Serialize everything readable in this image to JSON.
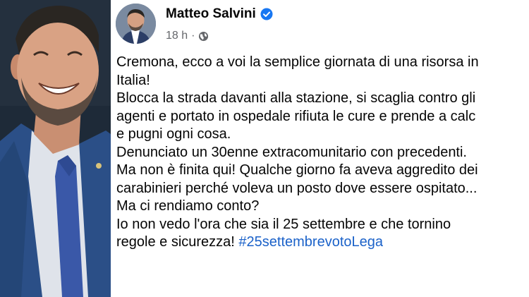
{
  "post": {
    "author": "Matteo Salvini",
    "verified_icon": "verified-badge-icon",
    "timestamp": "18 h",
    "separator": "·",
    "audience_icon": "globe-icon",
    "lines": [
      "Cremona, ecco a voi la semplice giornata di una risorsa in",
      "Italia!",
      "Blocca la strada davanti alla stazione, si scaglia contro gli",
      "agenti e portato in ospedale rifiuta le cure e prende a calc",
      "e pugni ogni cosa.",
      "Denunciato un 30enne extracomunitario con precedenti.",
      "Ma non è finita qui! Qualche giorno fa aveva aggredito dei",
      "carabinieri perché voleva un posto dove essere ospitato...",
      "Ma ci rendiamo conto?",
      "Io non vedo l'ora che sia il 25 settembre e che tornino"
    ],
    "last_line_text": "regole e sicurezza! ",
    "hashtag": "#25settembrevotoLega"
  },
  "colors": {
    "hashtag": "#1b62c9",
    "verified": "#1877f2",
    "meta": "#65676b"
  }
}
